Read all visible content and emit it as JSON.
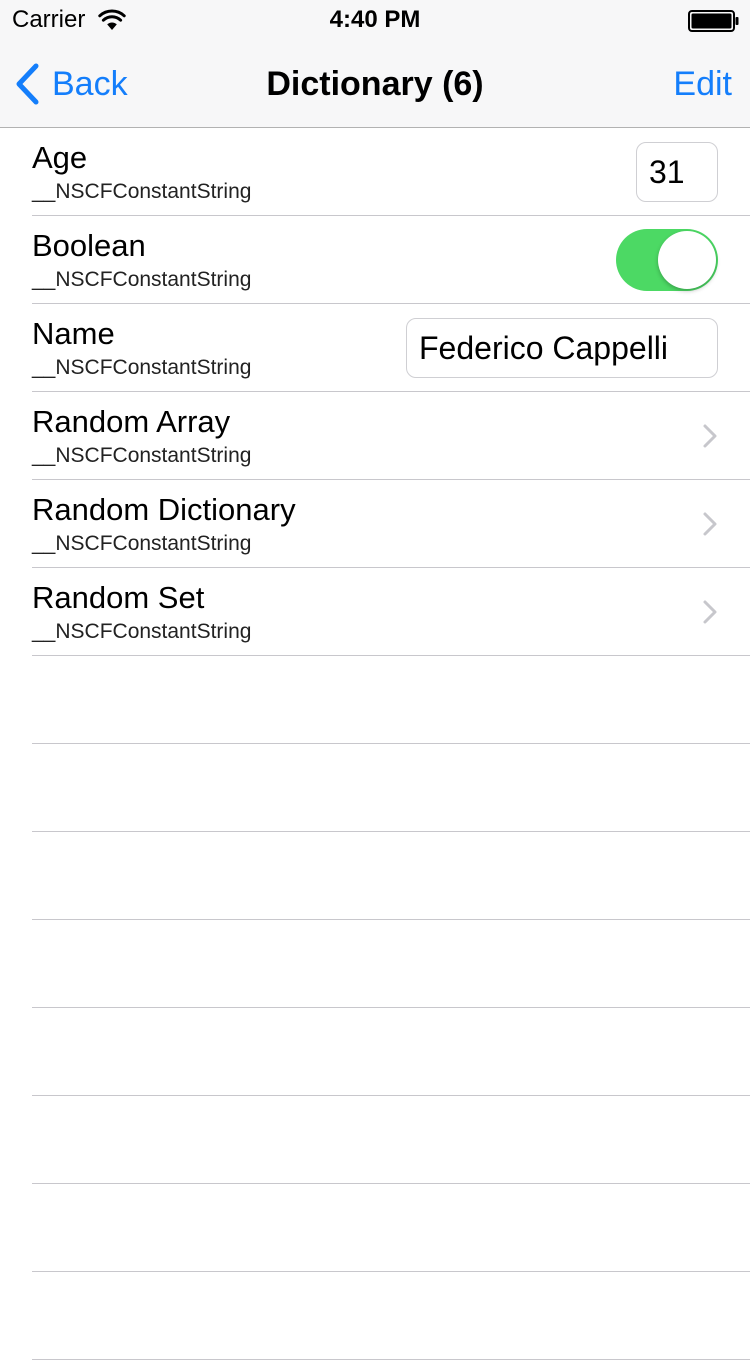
{
  "status_bar": {
    "carrier": "Carrier",
    "time": "4:40 PM"
  },
  "nav_bar": {
    "back_label": "Back",
    "title": "Dictionary (6)",
    "edit_label": "Edit"
  },
  "colors": {
    "tint": "#147efb",
    "switch_on": "#4cd964",
    "separator": "#c8c7cc"
  },
  "rows": [
    {
      "title": "Age",
      "subtitle": "__NSCFConstantString",
      "accessory": "text-field",
      "value": "31"
    },
    {
      "title": "Boolean",
      "subtitle": "__NSCFConstantString",
      "accessory": "switch",
      "value": "on"
    },
    {
      "title": "Name",
      "subtitle": "__NSCFConstantString",
      "accessory": "text-field",
      "value": "Federico Cappelli"
    },
    {
      "title": "Random Array",
      "subtitle": "__NSCFConstantString",
      "accessory": "chevron-right-icon"
    },
    {
      "title": "Random Dictionary",
      "subtitle": "__NSCFConstantString",
      "accessory": "chevron-right-icon"
    },
    {
      "title": "Random Set",
      "subtitle": "__NSCFConstantString",
      "accessory": "chevron-right-icon"
    }
  ]
}
